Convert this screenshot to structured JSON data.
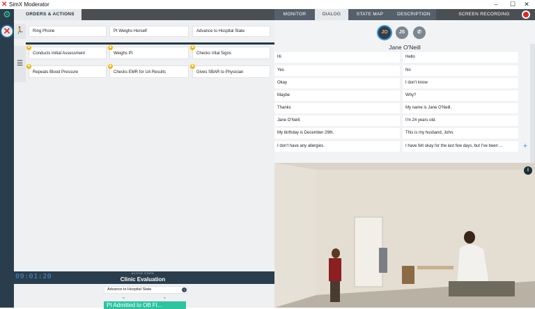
{
  "window": {
    "title": "SimX Moderator",
    "controls": [
      "–",
      "☐",
      "✕"
    ]
  },
  "tabs": {
    "orders": "ORDERS & ACTIONS",
    "monitor": "MONITOR",
    "dialog": "DIALOG",
    "state_map": "STATE MAP",
    "description": "DESCRIPTION",
    "recording": "SCREEN RECORDING"
  },
  "actions": {
    "row1": [
      "Ring Phone",
      "Pt Weighs Herself",
      "Advance to Hospital State"
    ],
    "row2": [
      "Conducts Initial Assessment",
      "Weighs Pt",
      "Checks Vital Signs"
    ],
    "row3": [
      "Repeats Blood Pressure",
      "Checks EMR for UA Results",
      "Gives SBAR to Physician"
    ]
  },
  "status": {
    "timer": "09:01:20",
    "active_state_label": "ACTIVE STATE",
    "active_state_name": "Clinic Evaluation",
    "advance_option": "Advance to Hospital State",
    "next_state": "Pt Admitted to OB Fl..."
  },
  "dialog": {
    "avatars": [
      "JO",
      "JS"
    ],
    "speaker": "Jane O'Neill",
    "lines": [
      [
        "Hi",
        "Hello"
      ],
      [
        "Yes",
        "No"
      ],
      [
        "Okay",
        "I don't know"
      ],
      [
        "Maybe",
        "Why?"
      ],
      [
        "Thanks",
        "My name is Jane O'Neill."
      ],
      [
        "Jane O'Neill.",
        "I'm 24 years old."
      ],
      [
        "My birthday is December 29th.",
        "This is my husband, John."
      ],
      [
        "I don't have any allergies.",
        "I have felt okay for the last few days, but I've been ..."
      ]
    ]
  },
  "colors": {
    "accent": "#2ec4a0",
    "rail": "#2a3d4c",
    "record": "#e0261c",
    "link": "#3c8fd4"
  },
  "icons": {
    "gear": "gear-icon",
    "close": "close-icon",
    "running": "running-person-icon",
    "checklist": "checklist-icon",
    "phone": "phone-icon",
    "info": "info-icon"
  }
}
